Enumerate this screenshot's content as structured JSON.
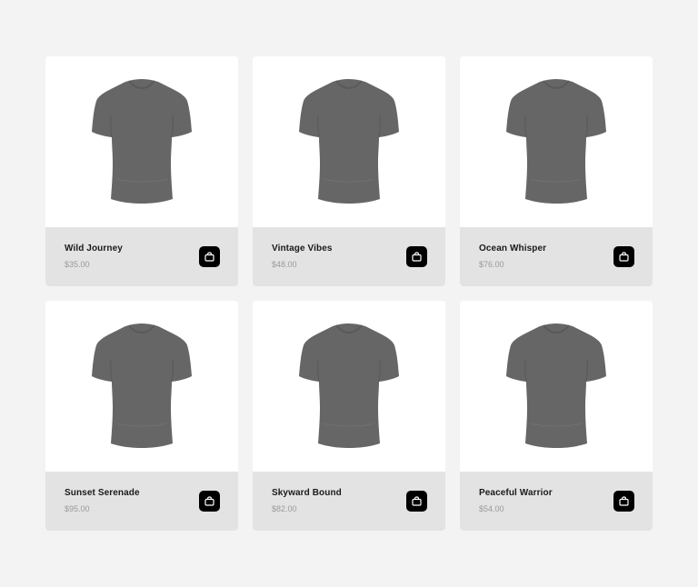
{
  "colors": {
    "page_background": "#f3f3f3",
    "card_footer": "#e3e3e3",
    "tshirt": "#666666",
    "cart_button": "#000000"
  },
  "icons": {
    "product_image": "tshirt-icon",
    "cart_button": "shopping-bag-icon"
  },
  "products": [
    {
      "name": "Wild Journey",
      "price": "$35.00"
    },
    {
      "name": "Vintage Vibes",
      "price": "$48.00"
    },
    {
      "name": "Ocean Whisper",
      "price": "$76.00"
    },
    {
      "name": "Sunset Serenade",
      "price": "$95.00"
    },
    {
      "name": "Skyward Bound",
      "price": "$82.00"
    },
    {
      "name": "Peaceful Warrior",
      "price": "$54.00"
    }
  ]
}
